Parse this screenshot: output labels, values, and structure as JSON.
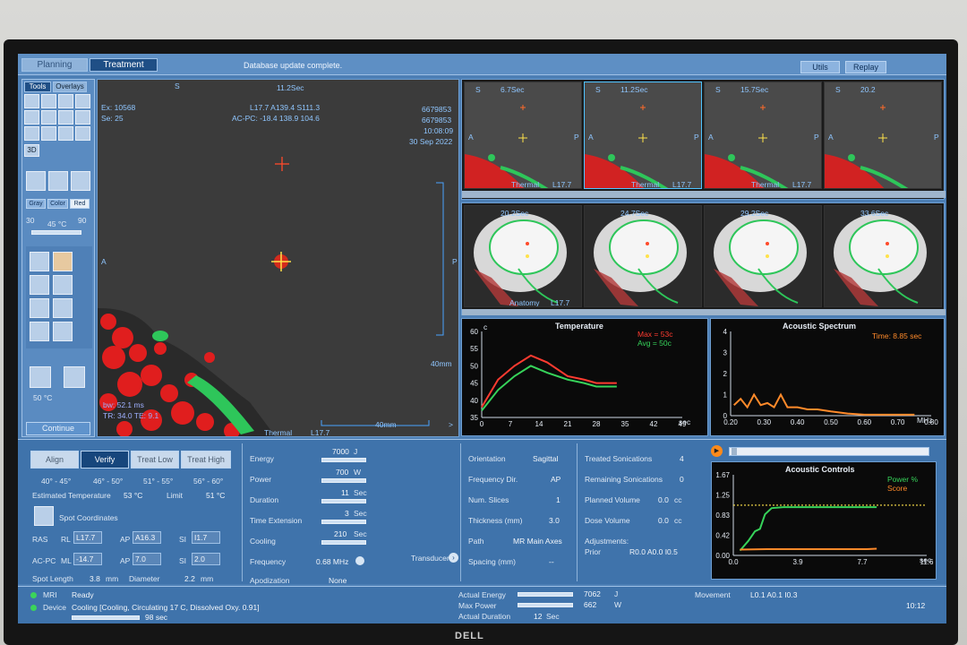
{
  "app": {
    "tab_planning": "Planning",
    "tab_treatment": "Treatment",
    "status": "Database update complete.",
    "utils": "Utils",
    "replay": "Replay"
  },
  "tools": {
    "tab_tools": "Tools",
    "tab_overlays": "Overlays",
    "btn_3d": "3D",
    "gray": "Gray",
    "color": "Color",
    "red": "Red",
    "t_min": "30",
    "t_cur": "45 °C",
    "t_max": "90",
    "t_bottom": "50 °C",
    "continue": "Continue"
  },
  "main_view": {
    "time": "11.2Sec",
    "s": "S",
    "a": "A",
    "p": "P",
    "ex": "Ex: 10568",
    "se": "Se: 25",
    "coord1": "L17.7 A139.4 S111.3",
    "coord2": "AC-PC: -18.4 138.9 104.6",
    "id1": "6679853",
    "id2": "6679853",
    "clock": "10:08:09",
    "date": "30 Sep 2022",
    "scale1": "40mm",
    "scale2": "40mm",
    "bw": "bw: 52.1 ms",
    "tr": "TR: 34.0 TE: 9.1",
    "thermal": "Thermal",
    "slice": "L17.7",
    "arrow": ">"
  },
  "thumbs_top": [
    {
      "time": "6.7Sec",
      "label": "Thermal",
      "slice": "L17.7"
    },
    {
      "time": "11.2Sec",
      "label": "Thermal",
      "slice": "L17.7"
    },
    {
      "time": "15.7Sec",
      "label": "Thermal",
      "slice": "L17.7"
    },
    {
      "time": "20.2",
      "label": "",
      "slice": ""
    }
  ],
  "thumbs_mid": [
    {
      "time": "20.2Sec",
      "label": "Anatomy",
      "slice": "L17.7"
    },
    {
      "time": "24.7Sec",
      "label": "",
      "slice": ""
    },
    {
      "time": "29.2Sec",
      "label": "",
      "slice": ""
    },
    {
      "time": "33.6Sec",
      "label": "",
      "slice": ""
    }
  ],
  "thumb_letters": {
    "s": "S",
    "a": "A",
    "p": "P"
  },
  "temp_chart": {
    "title": "Temperature",
    "unit": "c",
    "max": "Max = 53c",
    "avg": "Avg = 50c",
    "xunit": "sec",
    "yt": [
      "60",
      "55",
      "50",
      "45",
      "40",
      "35"
    ],
    "xt": [
      "0",
      "7",
      "14",
      "21",
      "28",
      "35",
      "42",
      "49"
    ]
  },
  "spec_chart": {
    "title": "Acoustic Spectrum",
    "time": "Time: 8.85 sec",
    "xunit": "MHz",
    "yt": [
      "4",
      "3",
      "2",
      "1",
      "0"
    ],
    "xt": [
      "0.20",
      "0.30",
      "0.40",
      "0.50",
      "0.60",
      "0.70",
      "0.80"
    ]
  },
  "ac_chart": {
    "title": "Acoustic Controls",
    "power": "Power %",
    "score": "Score",
    "xunit": "sec",
    "yt": [
      "1.67",
      "1.25",
      "0.83",
      "0.42",
      "0.00"
    ],
    "xt": [
      "0.0",
      "3.9",
      "7.7",
      "11.6"
    ]
  },
  "chart_data": [
    {
      "type": "line",
      "title": "Temperature",
      "ylabel": "c",
      "xlabel": "sec",
      "xlim": [
        0,
        49
      ],
      "ylim": [
        35,
        60
      ],
      "series": [
        {
          "name": "Max = 53c",
          "x": [
            0,
            4,
            8,
            12,
            16,
            21,
            25,
            28,
            31,
            33
          ],
          "values": [
            38,
            46,
            50,
            53,
            51,
            47,
            46,
            45,
            45,
            45
          ]
        },
        {
          "name": "Avg = 50c",
          "x": [
            0,
            4,
            8,
            12,
            16,
            21,
            25,
            28,
            31,
            33
          ],
          "values": [
            37,
            43,
            47,
            50,
            48,
            46,
            45,
            44,
            44,
            44
          ]
        }
      ]
    },
    {
      "type": "line",
      "title": "Acoustic Spectrum",
      "xlabel": "MHz",
      "xlim": [
        0.2,
        0.8
      ],
      "ylim": [
        0,
        4
      ],
      "series": [
        {
          "x": [
            0.21,
            0.23,
            0.25,
            0.27,
            0.29,
            0.31,
            0.33,
            0.35,
            0.37,
            0.4,
            0.43,
            0.46,
            0.5,
            0.55,
            0.6,
            0.65,
            0.7,
            0.75
          ],
          "values": [
            0.5,
            0.8,
            0.4,
            1.0,
            0.5,
            0.6,
            0.4,
            1.0,
            0.4,
            0.4,
            0.3,
            0.3,
            0.2,
            0.1,
            0.05,
            0.05,
            0.05,
            0.05
          ]
        }
      ]
    },
    {
      "type": "line",
      "title": "Acoustic Controls",
      "xlabel": "sec",
      "xlim": [
        0,
        11.6
      ],
      "ylim": [
        0,
        1.67
      ],
      "series": [
        {
          "name": "Power %",
          "x": [
            0.4,
            0.9,
            1.3,
            1.6,
            1.9,
            2.3,
            3,
            5,
            7,
            8.6
          ],
          "values": [
            0.1,
            0.3,
            0.5,
            0.55,
            0.85,
            0.98,
            1.0,
            1.0,
            1.0,
            1.0
          ]
        },
        {
          "name": "Score",
          "x": [
            0.4,
            2,
            4,
            6,
            8,
            8.6
          ],
          "values": [
            0.12,
            0.13,
            0.13,
            0.13,
            0.13,
            0.14
          ]
        }
      ]
    }
  ],
  "treat_buttons": {
    "align": "Align",
    "verify": "Verify",
    "low": "Treat Low",
    "high": "Treat High",
    "r1": "40° - 45°",
    "r2": "46° - 50°",
    "r3": "51° - 55°",
    "r4": "56° - 60°"
  },
  "params_left": {
    "est_temp_l": "Estimated Temperature",
    "est_temp_v": "53 °C",
    "limit_l": "Limit",
    "limit_v": "51 °C",
    "spot_coords": "Spot Coordinates",
    "ras": "RAS",
    "rl": "RL",
    "rl_v": "L17.7",
    "ap": "AP",
    "ap_v": "A16.3",
    "si": "SI",
    "si_v": "I1.7",
    "acpc": "AC-PC",
    "ml": "ML",
    "ml_v": "-14.7",
    "ap2_v": "7.0",
    "si2_v": "2.0",
    "spot_len_l": "Spot Length",
    "spot_len_v": "3.8",
    "mm": "mm",
    "diam_l": "Diameter",
    "diam_v": "2.2",
    "mm2": "mm"
  },
  "params_mid": {
    "energy_l": "Energy",
    "energy_v": "7000",
    "energy_u": "J",
    "power_l": "Power",
    "power_v": "700",
    "power_u": "W",
    "dur_l": "Duration",
    "dur_v": "11",
    "dur_u": "Sec",
    "ext_l": "Time Extension",
    "ext_v": "3",
    "ext_u": "Sec",
    "cool_l": "Cooling",
    "cool_v": "210",
    "cool_u": "Sec",
    "freq_l": "Frequency",
    "freq_v": "0.68 MHz",
    "apod_l": "Apodization",
    "apod_v": "None",
    "transducer": "Transducer"
  },
  "params_right": {
    "orient_l": "Orientation",
    "orient_v": "Sagittal",
    "fdir_l": "Frequency Dir.",
    "fdir_v": "AP",
    "nslices_l": "Num. Slices",
    "nslices_v": "1",
    "thick_l": "Thickness (mm)",
    "thick_v": "3.0",
    "path_l": "Path",
    "path_v": "MR Main Axes",
    "spacing_l": "Spacing (mm)",
    "spacing_v": "--"
  },
  "sonic": {
    "treated_l": "Treated Sonications",
    "treated_v": "4",
    "remain_l": "Remaining Sonications",
    "remain_v": "0",
    "pvol_l": "Planned Volume",
    "pvol_v": "0.0",
    "pvol_u": "cc",
    "dvol_l": "Dose Volume",
    "dvol_v": "0.0",
    "dvol_u": "cc",
    "adj_l": "Adjustments:",
    "prior_l": "Prior",
    "prior_v": "R0.0 A0.0 I0.5"
  },
  "status": {
    "mri_l": "MRI",
    "mri_v": "Ready",
    "dev_l": "Device",
    "dev_v": "Cooling [Cooling, Circulating 17 C, Dissolved Oxy. 0.91]",
    "sec_v": "98 sec",
    "ae_l": "Actual Energy",
    "ae_v": "7062",
    "ae_u": "J",
    "mp_l": "Max Power",
    "mp_v": "662",
    "mp_u": "W",
    "ad_l": "Actual Duration",
    "ad_v": "12",
    "ad_u": "Sec",
    "mov_l": "Movement",
    "mov_v": "L0.1 A0.1 I0.3",
    "clock": "10:12"
  },
  "logo": "DELL",
  "colors": {
    "max": "#ff3b30",
    "avg": "#36d35a",
    "spectrum": "#ff8a2a",
    "power": "#36d35a",
    "score": "#ff8a2a",
    "threshold": "#ffe24a"
  }
}
